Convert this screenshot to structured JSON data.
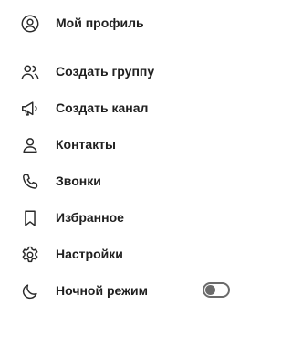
{
  "menu": {
    "profile": {
      "label": "Мой профиль",
      "icon": "user-circle-icon"
    },
    "items": [
      {
        "label": "Создать группу",
        "icon": "group-icon"
      },
      {
        "label": "Создать канал",
        "icon": "megaphone-icon"
      },
      {
        "label": "Контакты",
        "icon": "user-icon"
      },
      {
        "label": "Звонки",
        "icon": "phone-icon"
      },
      {
        "label": "Избранное",
        "icon": "bookmark-icon"
      },
      {
        "label": "Настройки",
        "icon": "gear-icon"
      },
      {
        "label": "Ночной режим",
        "icon": "moon-icon"
      }
    ],
    "night_mode_enabled": false
  }
}
